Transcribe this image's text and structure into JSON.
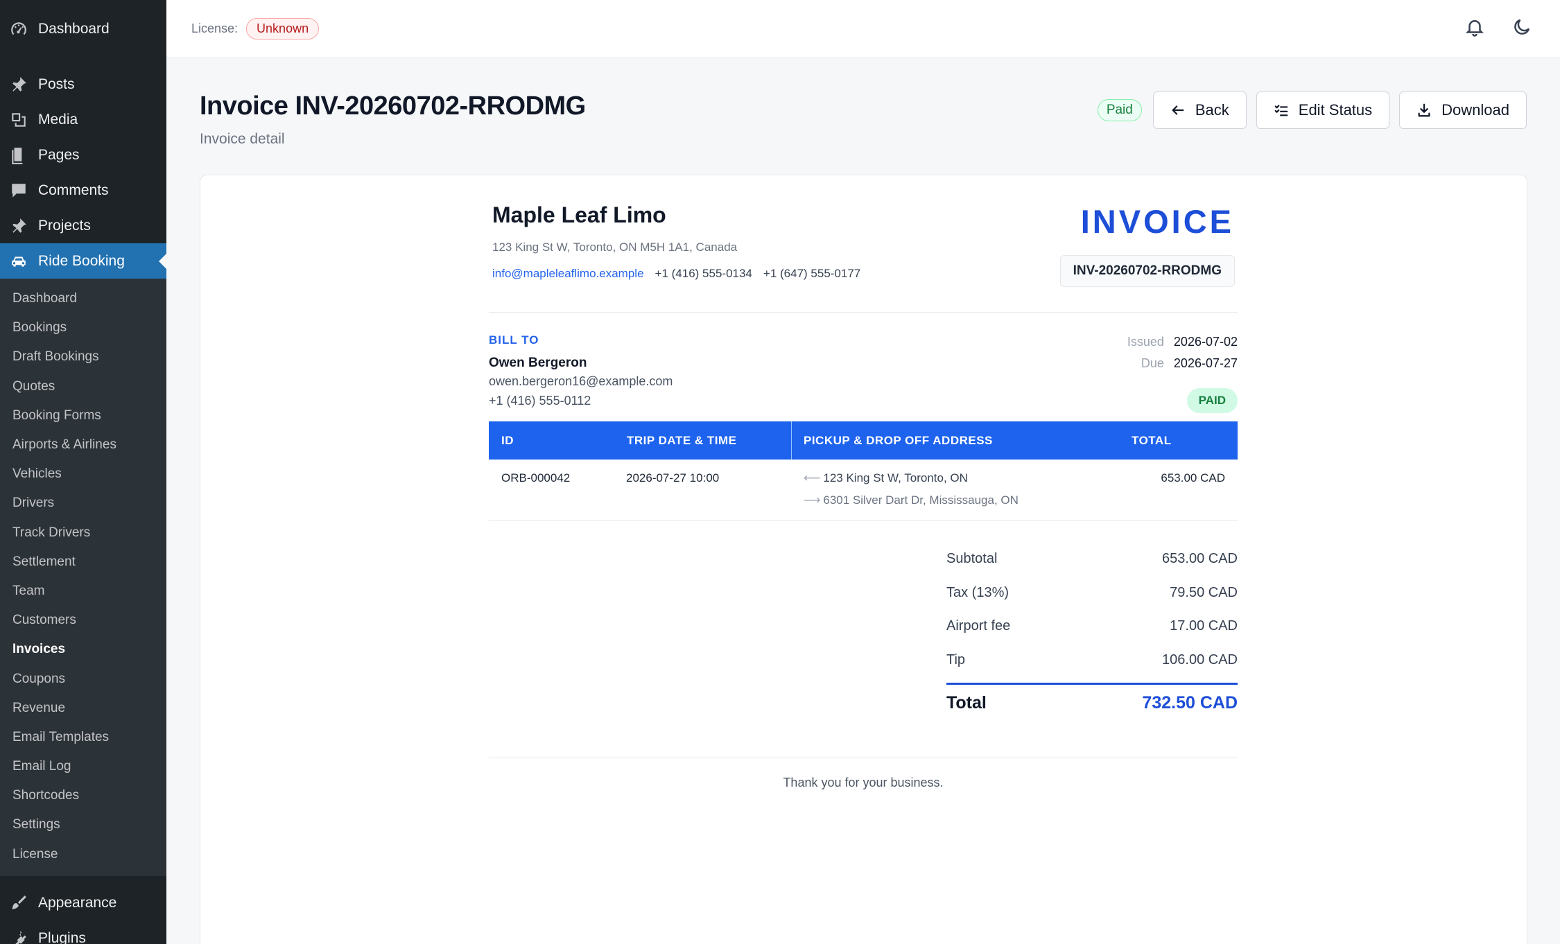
{
  "sidebar": {
    "top": {
      "label": "Dashboard",
      "icon": "dashboard-icon"
    },
    "items": [
      {
        "label": "Posts",
        "icon": "pin-icon"
      },
      {
        "label": "Media",
        "icon": "media-icon"
      },
      {
        "label": "Pages",
        "icon": "pages-icon"
      },
      {
        "label": "Comments",
        "icon": "comment-icon"
      },
      {
        "label": "Projects",
        "icon": "pin-icon"
      },
      {
        "label": "Ride Booking",
        "icon": "car-icon"
      }
    ],
    "submenu": [
      "Dashboard",
      "Bookings",
      "Draft Bookings",
      "Quotes",
      "Booking Forms",
      "Airports & Airlines",
      "Vehicles",
      "Drivers",
      "Track Drivers",
      "Settlement",
      "Team",
      "Customers",
      "Invoices",
      "Coupons",
      "Revenue",
      "Email Templates",
      "Email Log",
      "Shortcodes",
      "Settings",
      "License"
    ],
    "bottom": [
      {
        "label": "Appearance",
        "icon": "brush-icon"
      },
      {
        "label": "Plugins",
        "icon": "plug-icon"
      }
    ]
  },
  "topbar": {
    "license_label": "License:",
    "license_status": "Unknown"
  },
  "header": {
    "title": "Invoice INV-20260702-RRODMG",
    "subtitle": "Invoice detail",
    "status_pill": "Paid",
    "back_label": "Back",
    "edit_status_label": "Edit Status",
    "download_label": "Download"
  },
  "invoice": {
    "company": "Maple Leaf Limo",
    "address": "123 King St W, Toronto, ON M5H 1A1, Canada",
    "email": "info@mapleleaflimo.example",
    "phone1": "+1 (416) 555-0134",
    "phone2": "+1 (647) 555-0177",
    "heading": "INVOICE",
    "number": "INV-20260702-RRODMG",
    "bill_to_label": "BILL TO",
    "customer_name": "Owen Bergeron",
    "customer_email": "owen.bergeron16@example.com",
    "customer_phone": "+1 (416) 555-0112",
    "issued_label": "Issued",
    "issued": "2026-07-02",
    "due_label": "Due",
    "due": "2026-07-27",
    "status": "PAID",
    "columns": [
      "ID",
      "TRIP DATE & TIME",
      "PICKUP & DROP OFF ADDRESS",
      "TOTAL"
    ],
    "row": {
      "id": "ORB-000042",
      "trip_datetime": "2026-07-27 10:00",
      "pickup": "123 King St W, Toronto, ON",
      "dropoff": "6301 Silver Dart Dr, Mississauga, ON",
      "total": "653.00 CAD"
    },
    "summary": [
      {
        "label": "Subtotal",
        "value": "653.00 CAD"
      },
      {
        "label": "Tax (13%)",
        "value": "79.50 CAD"
      },
      {
        "label": "Airport fee",
        "value": "17.00 CAD"
      },
      {
        "label": "Tip",
        "value": "106.00 CAD"
      }
    ],
    "total_label": "Total",
    "total_value": "732.50 CAD",
    "thanks": "Thank you for your business."
  },
  "colors": {
    "accent": "#1d63ed",
    "sidebar": "#1d2327",
    "active": "#2271b1",
    "paid": "#15803d"
  }
}
